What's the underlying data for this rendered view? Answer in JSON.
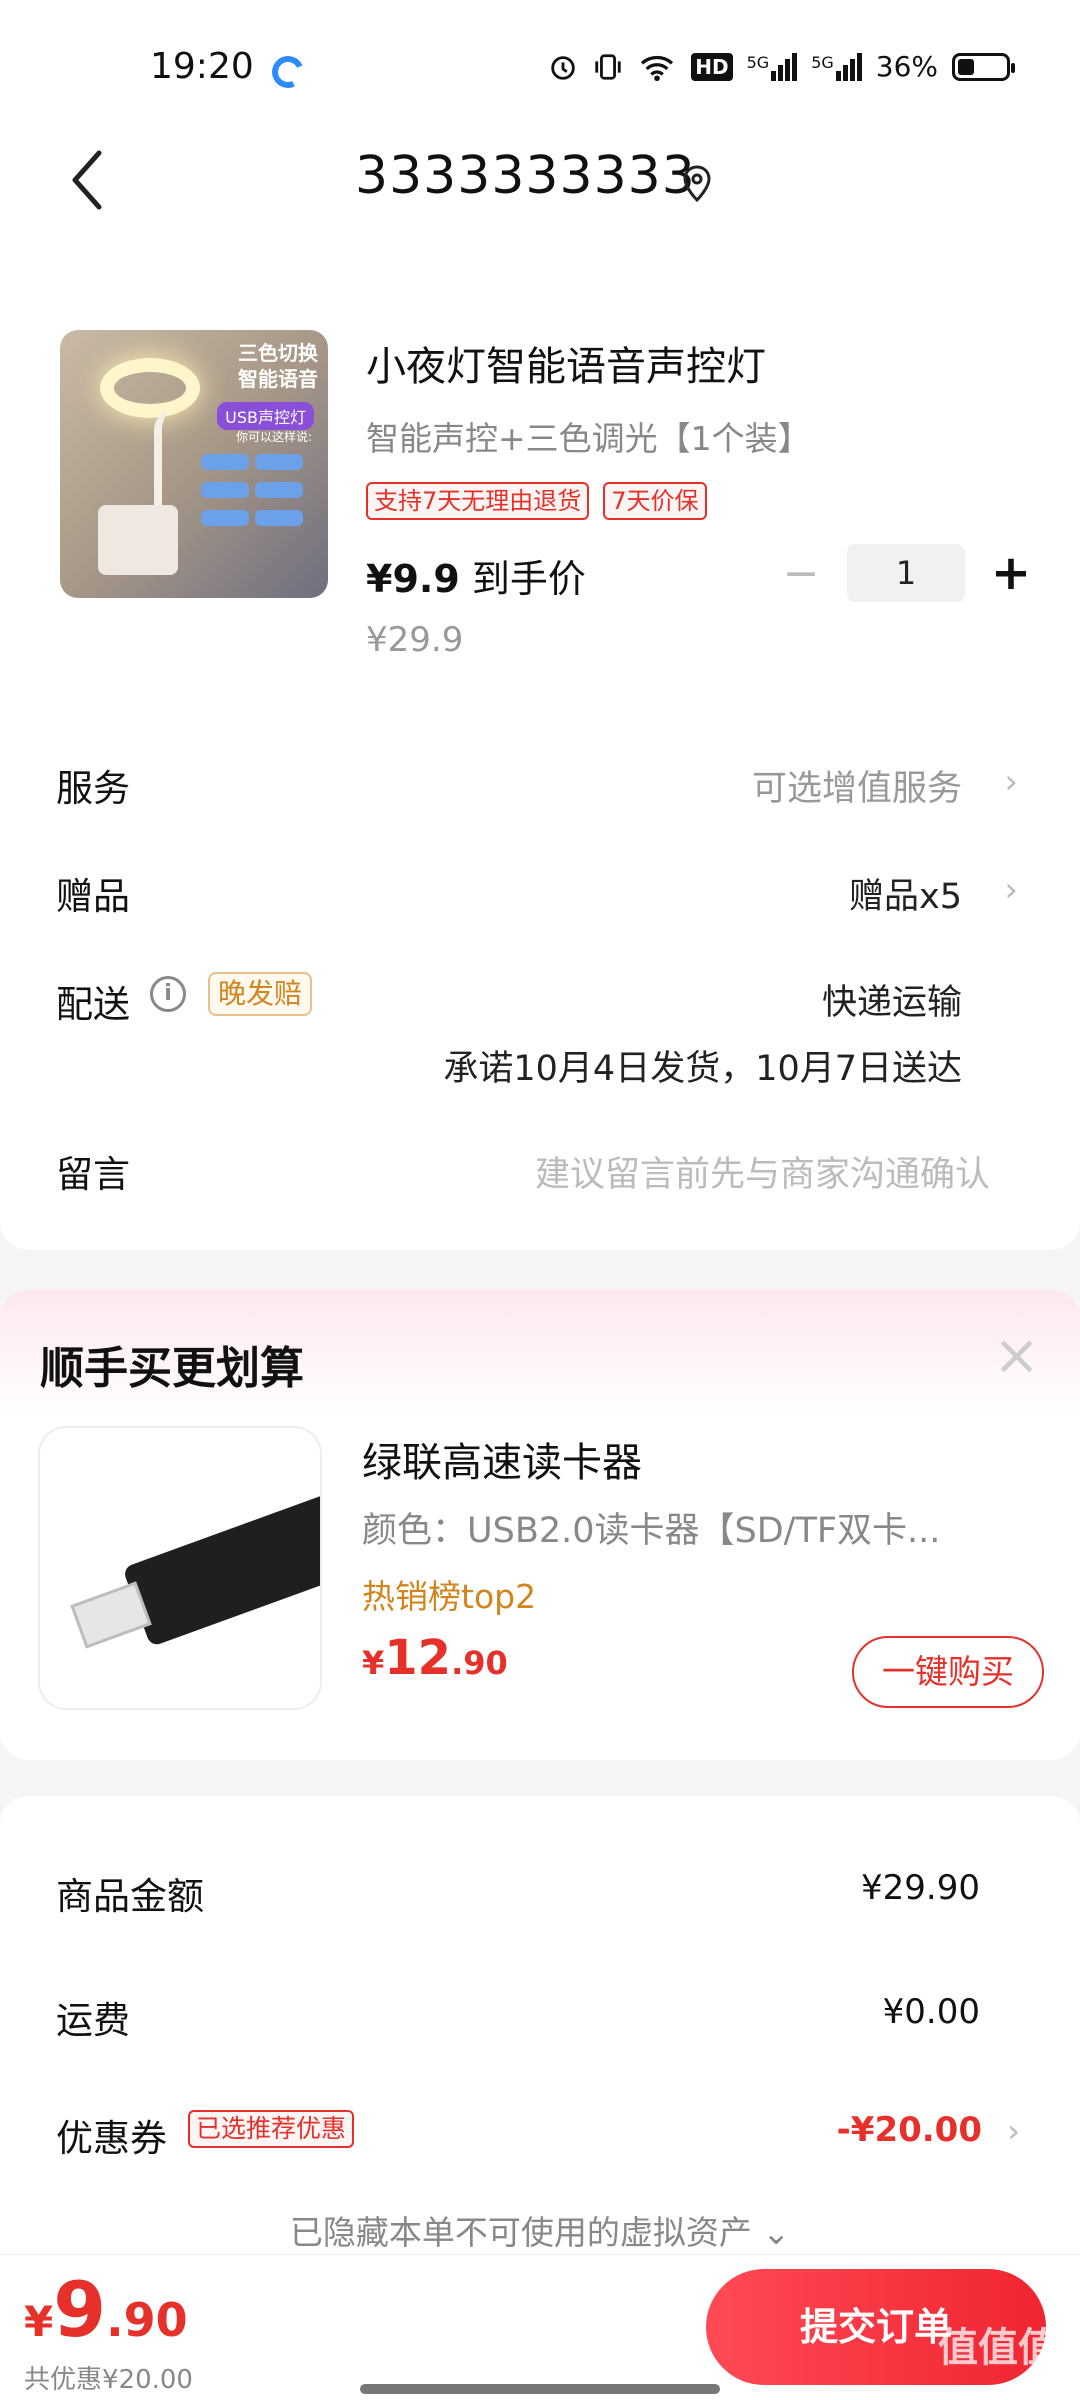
{
  "status_bar": {
    "time": "19:20",
    "battery": "36%",
    "net1": "5G",
    "net2": "5G",
    "hd": "HD"
  },
  "header": {
    "title": "3333333333"
  },
  "product": {
    "title": "小夜灯智能语音声控灯",
    "spec": "智能声控+三色调光【1个装】",
    "tags": [
      "支持7天无理由退货",
      "7天价保"
    ],
    "price_now_value": "¥9.9",
    "price_now_suffix": " 到手价",
    "price_orig": "¥29.9",
    "quantity": "1",
    "image_text": {
      "line1": "三色切换",
      "line2": "智能语音",
      "badge": "USB声控灯",
      "sub": "你可以这样说:"
    }
  },
  "rows": {
    "service": {
      "label": "服务",
      "value": "可选增值服务"
    },
    "gift": {
      "label": "赠品",
      "value": "赠品x5"
    },
    "delivery": {
      "label": "配送",
      "tag": "晚发赔",
      "value": "快递运输",
      "promise": "承诺10月4日发货，10月7日送达"
    },
    "message": {
      "label": "留言",
      "placeholder": "建议留言前先与商家沟通确认"
    }
  },
  "recommend": {
    "title": "顺手买更划算",
    "product_title": "绿联高速读卡器",
    "spec": "颜色：USB2.0读卡器【SD/TF双卡...",
    "rank": "热销榜top2",
    "price_sym": "¥",
    "price_int": "12",
    "price_dec": ".90",
    "buy_label": "一键购买"
  },
  "summary": {
    "goods_label": "商品金额",
    "goods_value": "¥29.90",
    "shipping_label": "运费",
    "shipping_value": "¥0.00",
    "coupon_label": "优惠券",
    "coupon_tag": "已选推荐优惠",
    "coupon_value": "-¥20.00",
    "hidden_assets": "已隐藏本单不可使用的虚拟资产 ⌄"
  },
  "bottom": {
    "total_sym": "¥",
    "total_int": "9",
    "total_dec": ".90",
    "saved": "共优惠¥20.00",
    "submit_label": "提交订单",
    "watermark": "值值值"
  },
  "colors": {
    "accent": "#e5312a",
    "orange": "#d2851c",
    "submit": "#ef2531"
  }
}
